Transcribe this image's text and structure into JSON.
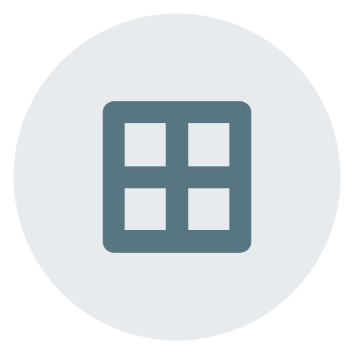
{
  "icon": {
    "name": "grid-view-icon",
    "background_color": "#e8ebee",
    "glyph_color": "#577682"
  }
}
